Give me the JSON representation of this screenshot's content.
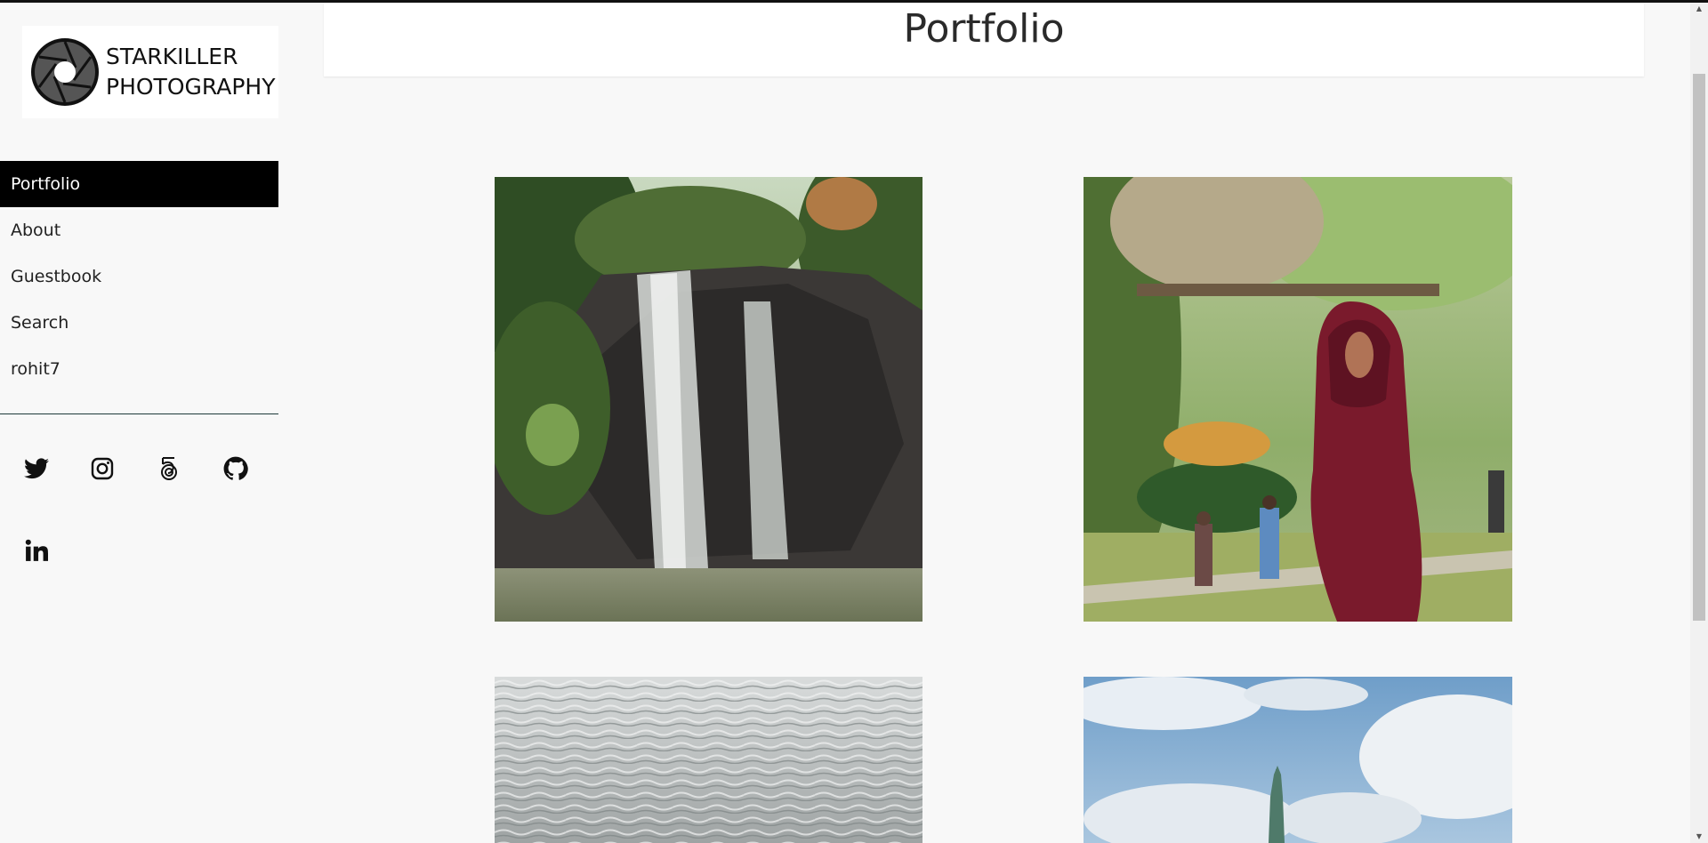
{
  "logo": {
    "line1": "STARKILLER",
    "line2": "PHOTOGRAPHY"
  },
  "nav": {
    "items": [
      {
        "label": "Portfolio",
        "active": true
      },
      {
        "label": "About",
        "active": false
      },
      {
        "label": "Guestbook",
        "active": false
      },
      {
        "label": "Search",
        "active": false
      },
      {
        "label": "rohit7",
        "active": false
      }
    ]
  },
  "social": [
    "twitter-icon",
    "instagram-icon",
    "500px-icon",
    "github-icon",
    "linkedin-icon"
  ],
  "main": {
    "title": "Portfolio"
  },
  "photos": [
    {
      "name": "photo-waterfall",
      "subject": "waterfall"
    },
    {
      "name": "photo-girl-in-scarf",
      "subject": "portrait"
    },
    {
      "name": "photo-water-surface",
      "subject": "water"
    },
    {
      "name": "photo-statue-of-liberty",
      "subject": "statue"
    }
  ],
  "colors": {
    "background": "#f8f8f8",
    "active_nav": "#000000",
    "divider": "#1f3b3b"
  }
}
